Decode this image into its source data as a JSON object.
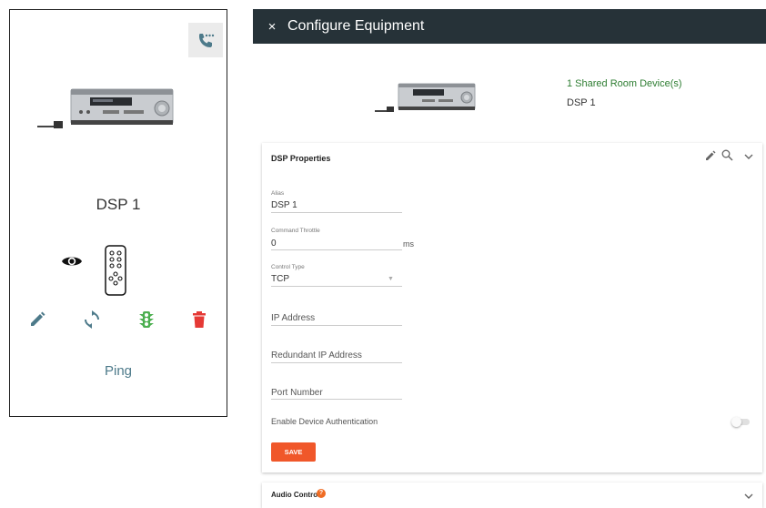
{
  "left_card": {
    "device_name": "DSP 1",
    "ping_label": "Ping",
    "icons": {
      "call": "phone-more-icon",
      "view": "eye-icon",
      "remote": "remote-control-icon",
      "edit": "pencil-icon",
      "sync": "sync-icon",
      "traffic": "traffic-light-icon",
      "delete": "trash-icon"
    },
    "colors": {
      "edit": "#4d7a8a",
      "sync": "#4d7a8a",
      "traffic": "#4caf50",
      "delete": "#e53935"
    }
  },
  "header": {
    "close_label": "×",
    "title": "Configure Equipment",
    "background": "#263238"
  },
  "shared": {
    "link_text": "1 Shared Room Device(s)",
    "device_name": "DSP 1",
    "link_color": "#2e7d32"
  },
  "dsp_panel": {
    "title": "DSP Properties",
    "icons": [
      "pencil-icon",
      "search-icon",
      "chevron-down-icon"
    ],
    "fields": {
      "alias": {
        "label": "Alias",
        "value": "DSP 1"
      },
      "command_throttle": {
        "label": "Command Throttle",
        "value": "0",
        "suffix": "ms"
      },
      "control_type": {
        "label": "Control Type",
        "value": "TCP"
      },
      "ip_address": {
        "placeholder": "IP Address"
      },
      "redundant_ip": {
        "placeholder": "Redundant IP Address"
      },
      "port_number": {
        "placeholder": "Port Number"
      }
    },
    "enable_auth": {
      "label": "Enable Device Authentication",
      "enabled": false
    },
    "save_label": "SAVE",
    "save_color": "#f0572a"
  },
  "audio_panel": {
    "title": "Audio Controls",
    "help_icon": "?"
  }
}
